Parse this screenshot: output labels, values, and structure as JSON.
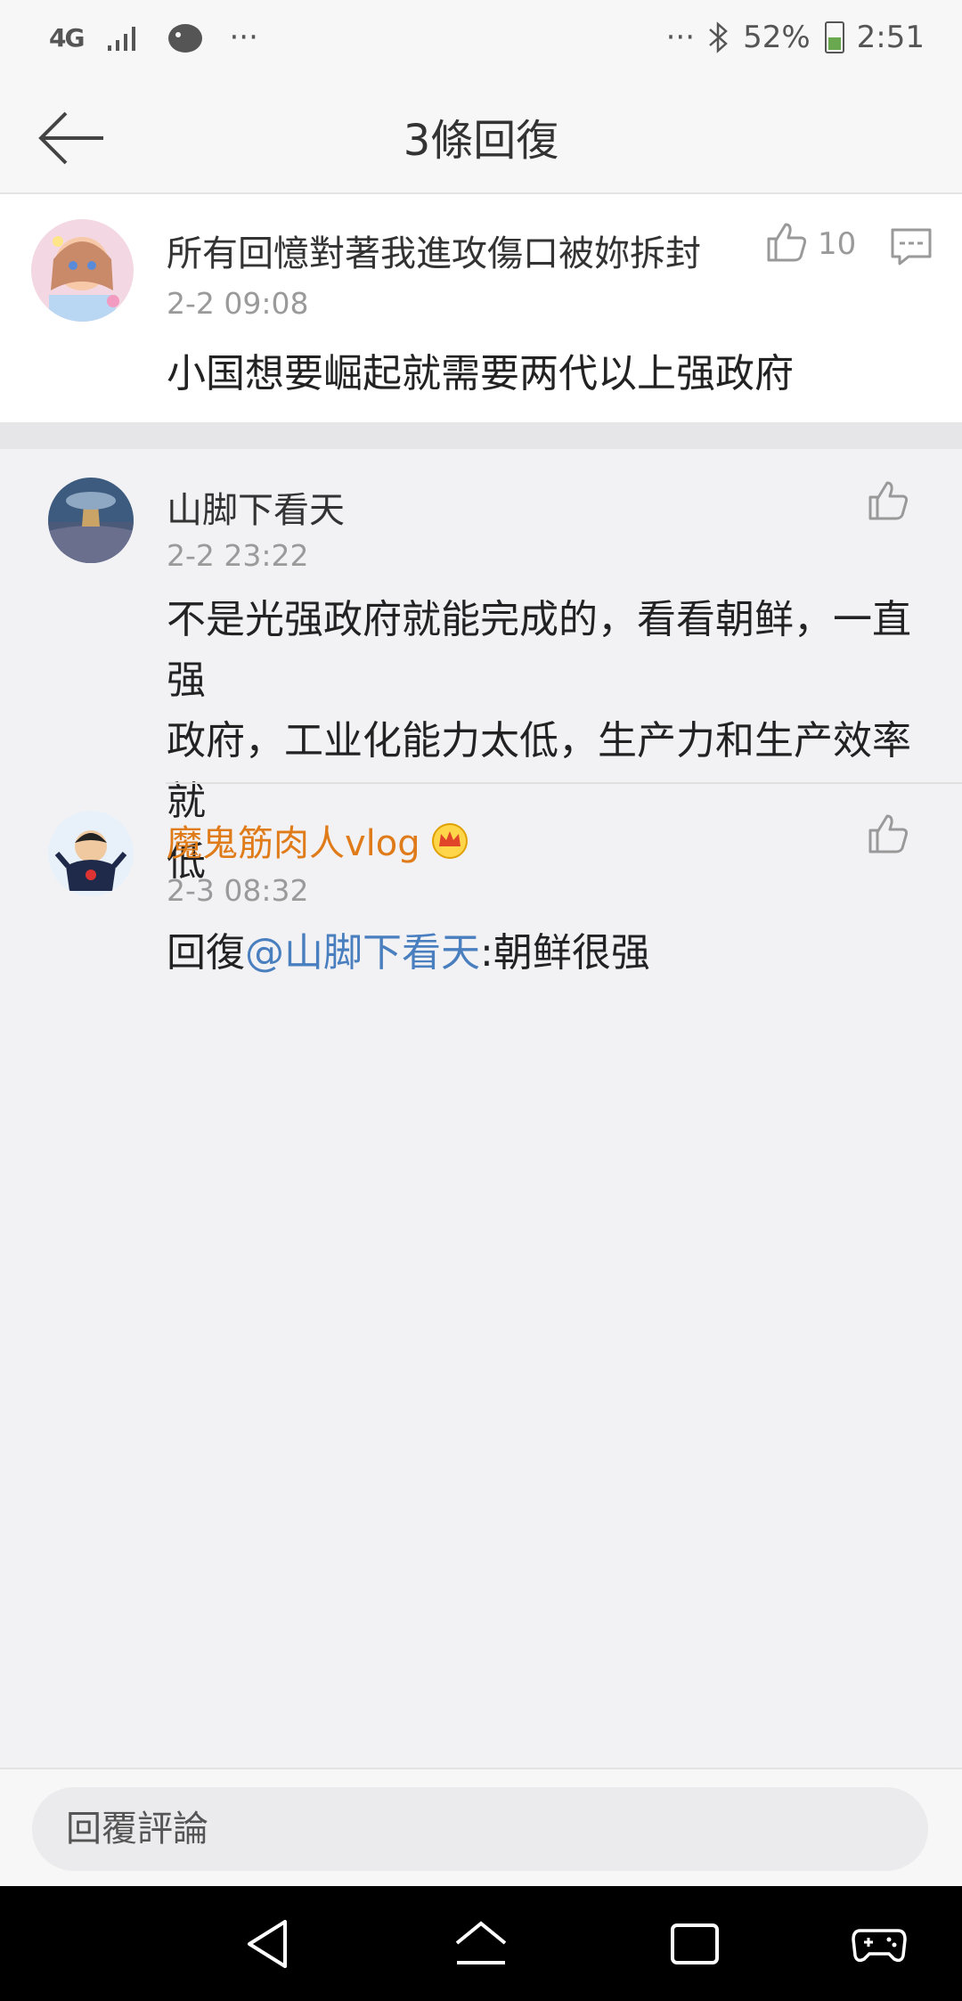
{
  "status_bar": {
    "network": "4G",
    "dots": "···",
    "right_dots": "···",
    "battery": "52%",
    "time": "2:51"
  },
  "header": {
    "title": "3條回復"
  },
  "main_comment": {
    "username": "所有回憶對著我進攻傷口被妳拆封",
    "time": "2-2 09:08",
    "content": "小国想要崛起就需要两代以上强政府",
    "like_count": "10"
  },
  "replies": [
    {
      "username": "山脚下看天",
      "time": "2-2 23:22",
      "content_lines": [
        "不是光强政府就能完成的，看看朝鲜，一直强",
        "政府，工业化能力太低，生产力和生产效率就",
        "低"
      ]
    },
    {
      "username": "魔鬼筋肉人vlog",
      "time": "2-3 08:32",
      "reply_prefix": "回復",
      "mention": "@山脚下看天",
      "reply_text": ":朝鲜很强"
    }
  ],
  "bottom": {
    "input_placeholder": "回覆評論"
  },
  "colors": {
    "mention": "#4a7fbf",
    "vip_name": "#e07b1a",
    "background": "#f2f2f5"
  }
}
